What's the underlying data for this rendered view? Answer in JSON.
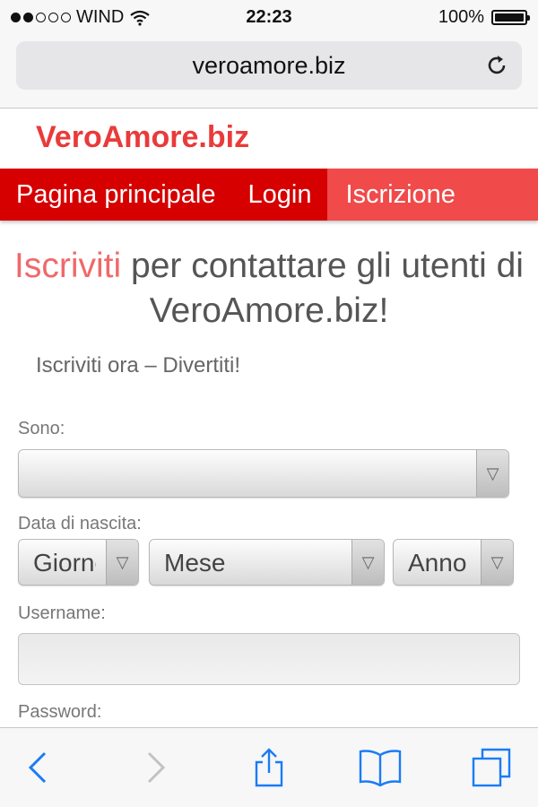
{
  "status": {
    "carrier": "WIND",
    "time": "22:23",
    "battery": "100%"
  },
  "browser": {
    "url": "veroamore.biz"
  },
  "site": {
    "logo": "VeroAmore.biz",
    "nav": [
      {
        "label": "Pagina principale"
      },
      {
        "label": "Login"
      },
      {
        "label": "Iscrizione"
      }
    ],
    "headline_accent": "Iscriviti",
    "headline_rest": " per contattare gli utenti di VeroAmore.biz!",
    "subtitle": "Iscriviti ora – Divertiti!"
  },
  "form": {
    "gender_label": "Sono:",
    "gender_value": "",
    "dob_label": "Data di nascita:",
    "day_value": "Giorno",
    "month_value": "Mese",
    "year_value": "Anno",
    "username_label": "Username:",
    "password_label": "Password:"
  },
  "colors": {
    "brand": "#d60000",
    "accent": "#f0696b",
    "ios_blue": "#1a7cf5"
  }
}
